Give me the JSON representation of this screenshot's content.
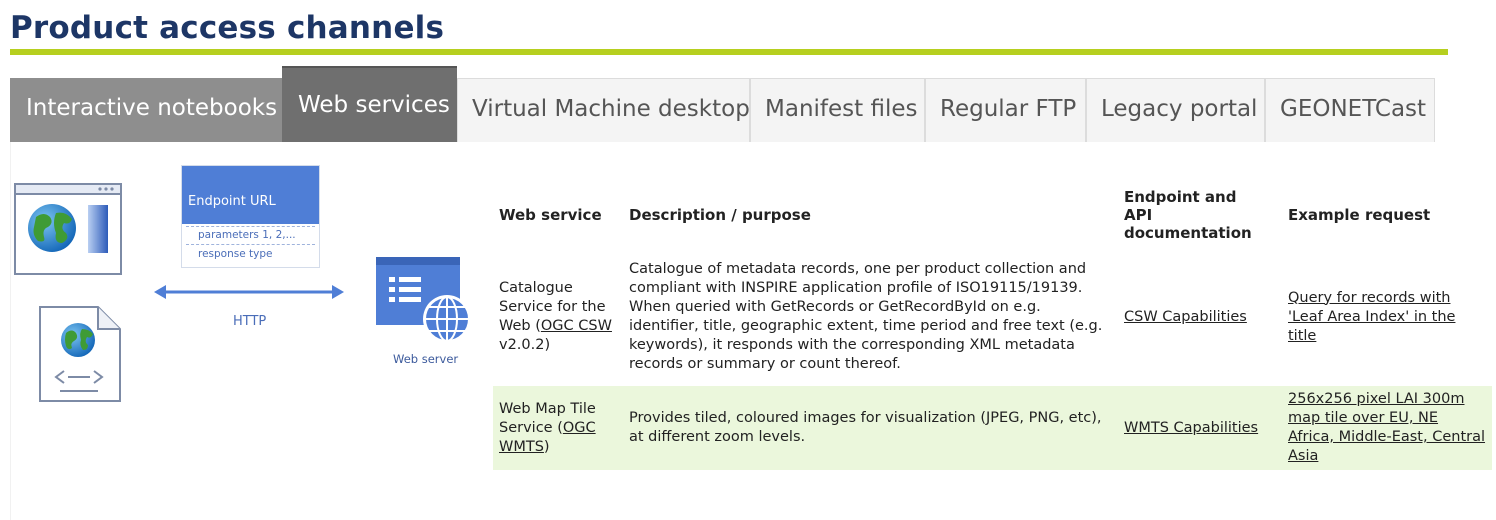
{
  "page": {
    "title": "Product access channels"
  },
  "colors": {
    "title": "#1d3666",
    "rule": "#b6cf1f",
    "tab_dark": "#8e8e8e",
    "tab_active": "#6f6f6f",
    "row_alt": "#ebf7dc"
  },
  "tabs": [
    {
      "label": "Interactive notebooks",
      "state": "inactive-dark"
    },
    {
      "label": "Web services",
      "state": "active"
    },
    {
      "label": "Virtual Machine desktop",
      "state": "inactive"
    },
    {
      "label": "Manifest files",
      "state": "inactive"
    },
    {
      "label": "Regular FTP",
      "state": "inactive"
    },
    {
      "label": "Legacy portal",
      "state": "inactive"
    },
    {
      "label": "GEONETCast",
      "state": "inactive"
    }
  ],
  "diagram": {
    "endpoint_title": "Endpoint URL",
    "params_text": "parameters 1, 2,...",
    "response_text": "response type",
    "http_label": "HTTP",
    "server_label": "Web server",
    "icons": [
      "browser-globe-icon",
      "xml-document-icon",
      "web-server-icon",
      "double-arrow-icon"
    ]
  },
  "table": {
    "headers": {
      "service": "Web service",
      "description": "Description / purpose",
      "endpoint_line1": "Endpoint and",
      "endpoint_line2": "API",
      "endpoint_line3": "documentation",
      "example": "Example request"
    },
    "rows": [
      {
        "service_pre": "Catalogue Service for the Web (",
        "service_link": "OGC CSW",
        "service_post": " v2.0.2)",
        "description": "Catalogue of metadata records, one per product collection and compliant with INSPIRE application profile of ISO19115/19139. When queried with GetRecords or GetRecordById on e.g. identifier, title, geographic extent, time period and free text (e.g. keywords), it responds with the corresponding XML metadata records or summary or count thereof.",
        "endpoint_link": "CSW Capabilities",
        "example_link": "Query for records with 'Leaf Area Index' in the title"
      },
      {
        "service_pre": "Web Map Tile Service (",
        "service_link": "OGC WMTS",
        "service_post": ")",
        "description": "Provides tiled, coloured images for visualization (JPEG, PNG, etc), at different zoom levels.",
        "endpoint_link": "WMTS Capabilities",
        "example_link": "256x256 pixel LAI 300m map tile over EU, NE Africa, Middle-East, Central Asia"
      }
    ]
  }
}
